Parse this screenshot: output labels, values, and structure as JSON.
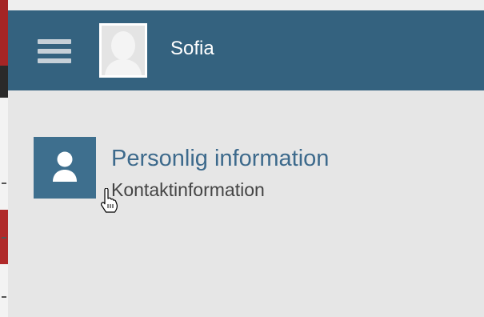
{
  "header": {
    "menu_icon": "hamburger-menu-icon",
    "avatar_icon": "default-user-avatar",
    "username": "Sofia",
    "bg_color": "#34627f"
  },
  "main": {
    "items": [
      {
        "icon": "person-icon",
        "title": "Personlig information",
        "subtitle": "Kontaktinformation"
      }
    ]
  },
  "colors": {
    "content_bg": "#e6e6e6",
    "item_icon_bg": "#3e6f8e",
    "title_color": "#3d6a8c",
    "subtitle_color": "#444444"
  }
}
